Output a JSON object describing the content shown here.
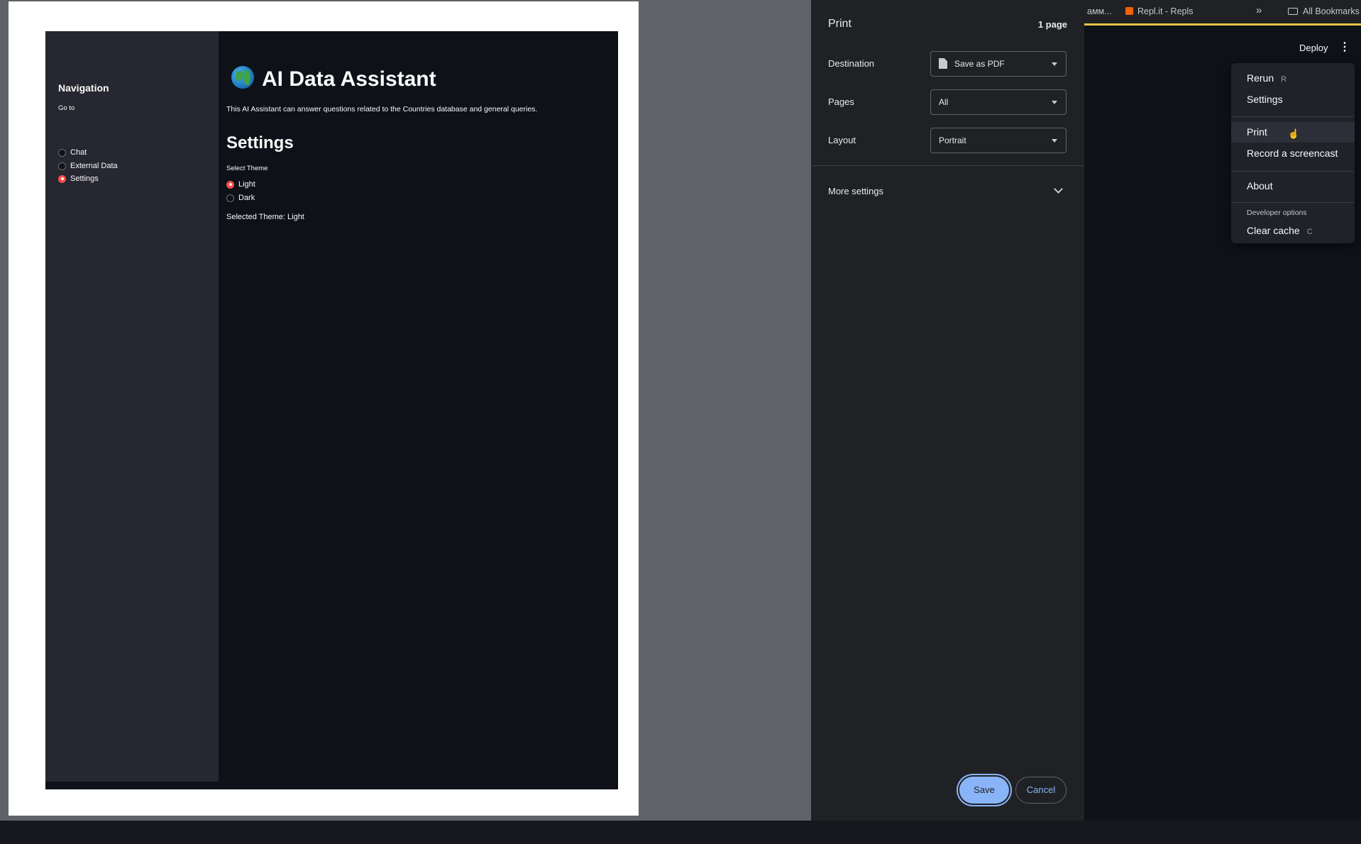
{
  "browser": {
    "bookmarks": {
      "truncated_item": "амм...",
      "replit_item": "Repl.it - Repls",
      "overflow": "»",
      "all_bookmarks": "All Bookmarks"
    },
    "deploy_label": "Deploy",
    "kebab_label": "⋮"
  },
  "main_menu": {
    "rerun": {
      "label": "Rerun",
      "shortcut": "R"
    },
    "settings": {
      "label": "Settings"
    },
    "print": {
      "label": "Print"
    },
    "record": {
      "label": "Record a screencast"
    },
    "about": {
      "label": "About"
    },
    "developer_options": "Developer options",
    "clear_cache": {
      "label": "Clear cache",
      "shortcut": "C"
    }
  },
  "preview": {
    "sidebar": {
      "title": "Navigation",
      "go_to": "Go to",
      "options": [
        {
          "label": "Chat",
          "selected": false
        },
        {
          "label": "External Data",
          "selected": false
        },
        {
          "label": "Settings",
          "selected": true
        }
      ]
    },
    "main": {
      "title": "AI Data Assistant",
      "description": "This AI Assistant can answer questions related to the Countries database and general queries.",
      "section_heading": "Settings",
      "select_theme_label": "Select Theme",
      "theme_options": [
        {
          "label": "Light",
          "selected": true
        },
        {
          "label": "Dark",
          "selected": false
        }
      ],
      "selected_theme_text": "Selected Theme: Light"
    }
  },
  "print_dialog": {
    "title": "Print",
    "page_count": "1 page",
    "destination": {
      "label": "Destination",
      "value": "Save as PDF"
    },
    "pages": {
      "label": "Pages",
      "value": "All"
    },
    "layout": {
      "label": "Layout",
      "value": "Portrait"
    },
    "more_settings": "More settings",
    "save_label": "Save",
    "cancel_label": "Cancel"
  },
  "colors": {
    "accent_red": "#ff4b4b",
    "print_blue": "#8ab4f8",
    "app_bg": "#0e1117",
    "sidebar_bg": "#262730"
  }
}
